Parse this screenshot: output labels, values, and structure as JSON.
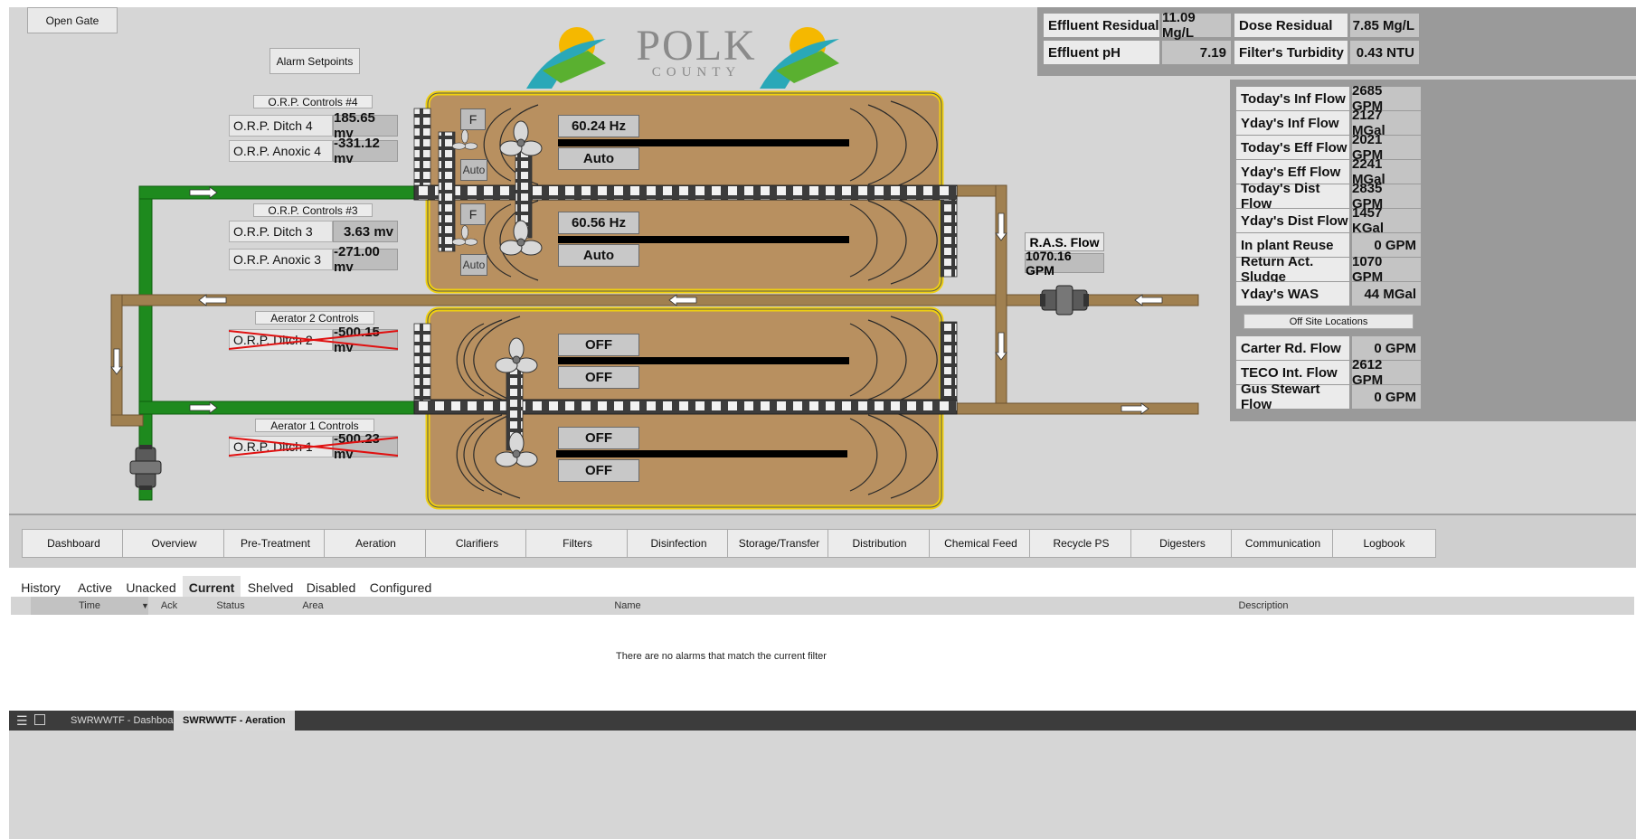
{
  "header": {
    "open_gate": "Open Gate",
    "alarm_setpoints": "Alarm Setpoints",
    "logo_text": "POLK",
    "logo_subtext": "COUNTY"
  },
  "orp4": {
    "title": "O.R.P. Controls #4",
    "ditch_label": "O.R.P. Ditch 4",
    "ditch_value": "185.65 mv",
    "anoxic_label": "O.R.P. Anoxic 4",
    "anoxic_value": "-331.12 mv"
  },
  "orp3": {
    "title": "O.R.P. Controls #3",
    "ditch_label": "O.R.P. Ditch 3",
    "ditch_value": "3.63 mv",
    "anoxic_label": "O.R.P. Anoxic 3",
    "anoxic_value": "-271.00 mv"
  },
  "aerator2": {
    "title": "Aerator 2 Controls",
    "label": "O.R.P. Ditch 2",
    "value": "-500.15 mv"
  },
  "aerator1": {
    "title": "Aerator 1 Controls",
    "label": "O.R.P. Ditch 1",
    "value": "-500.23 mv"
  },
  "basins": {
    "top": [
      {
        "f": "F",
        "auto_small": "Auto",
        "hz": "60.24 Hz",
        "mode": "Auto"
      },
      {
        "f": "F",
        "auto_small": "Auto",
        "hz": "60.56 Hz",
        "mode": "Auto"
      }
    ],
    "bottom": [
      {
        "state": "OFF",
        "mode": "OFF"
      },
      {
        "state": "OFF",
        "mode": "OFF"
      }
    ]
  },
  "ras": {
    "label": "R.A.S. Flow",
    "value": "1070.16 GPM"
  },
  "top_metrics": [
    {
      "label": "Effluent Residual",
      "value": "11.09 Mg/L"
    },
    {
      "label": "Dose Residual",
      "value": "7.85 Mg/L"
    },
    {
      "label": "Effluent pH",
      "value": "7.19"
    },
    {
      "label": "Filter's Turbidity",
      "value": "0.43 NTU"
    }
  ],
  "flows": [
    {
      "label": "Today's Inf Flow",
      "value": "2685 GPM"
    },
    {
      "label": "Yday's Inf Flow",
      "value": "2127 MGal"
    },
    {
      "label": "Today's Eff Flow",
      "value": "2021 GPM"
    },
    {
      "label": "Yday's Eff Flow",
      "value": "2241 MGal"
    },
    {
      "label": "Today's Dist Flow",
      "value": "2835 GPM"
    },
    {
      "label": "Yday's Dist Flow",
      "value": "1457 KGal"
    },
    {
      "label": "In plant Reuse",
      "value": "0 GPM"
    },
    {
      "label": "Return Act. Sludge",
      "value": "1070 GPM"
    },
    {
      "label": "Yday's WAS",
      "value": "44 MGal"
    }
  ],
  "offsite": {
    "title": "Off Site Locations",
    "items": [
      {
        "label": "Carter Rd. Flow",
        "value": "0 GPM"
      },
      {
        "label": "TECO Int. Flow",
        "value": "2612 GPM"
      },
      {
        "label": "Gus Stewart Flow",
        "value": "0 GPM"
      }
    ]
  },
  "nav": [
    "Dashboard",
    "Overview",
    "Pre-Treatment",
    "Aeration",
    "Clarifiers",
    "Filters",
    "Disinfection",
    "Storage/Transfer",
    "Distribution",
    "Chemical Feed",
    "Recycle PS",
    "Digesters",
    "Communication",
    "Logbook"
  ],
  "alarm_tabs": [
    "History",
    "Active",
    "Unacked",
    "Current",
    "Shelved",
    "Disabled",
    "Configured"
  ],
  "alarm_active_tab": "Current",
  "alarm_columns": [
    "Time",
    "Ack",
    "Status",
    "Area",
    "Name",
    "Description"
  ],
  "alarm_empty": "There are no alarms that match the current filter",
  "taskbar": {
    "tab1": "SWRWWTF - Dashboard",
    "tab2": "SWRWWTF - Aeration"
  },
  "colors": {
    "effluent_pipe": "#1e8a1e",
    "ras_pipe": "#a08050",
    "basin": "#b89060",
    "basin_border": "#f0d010"
  }
}
